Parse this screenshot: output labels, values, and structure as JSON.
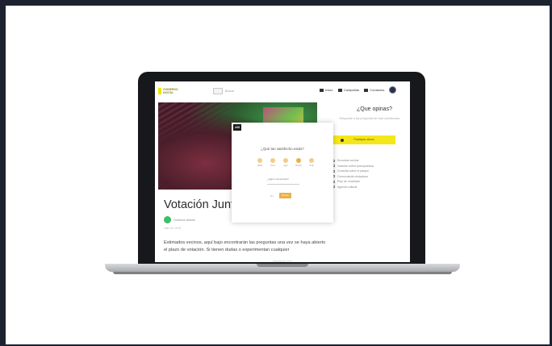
{
  "device": {
    "model_label": "MacBook Pro"
  },
  "site": {
    "logo_line1": "GOBIERNO",
    "logo_line2": "DIGITAL",
    "search_placeholder": "Buscar",
    "nav": [
      {
        "label": "Inicio",
        "icon": "home-icon"
      },
      {
        "label": "Campañas",
        "icon": "megaphone-icon"
      },
      {
        "label": "Contactos",
        "icon": "contacts-icon"
      }
    ]
  },
  "article": {
    "title": "Votación Junta",
    "author": "Gobierno Abierto",
    "meta": "Julio 20, 2019",
    "body": "Estimados vecinos, aquí bajo encontrarán las preguntas una vez se haya abierto el plazo de votación. Si tienen dudas o experimentan cualquier"
  },
  "sidebar": {
    "title": "¿Que opinas?",
    "description": "Responde a las preguntas de esta cuestionario",
    "button_label": "Participar ahora",
    "items": [
      "Encuesta vecinal",
      "Votación sobre presupuestos",
      "Consulta sobre el parque",
      "Convocatoria ciudadana",
      "Plan de movilidad",
      "Agenda cultural"
    ]
  },
  "modal": {
    "badge": "ASI",
    "question": "¿Qué tan satisfecho estás?",
    "options": [
      {
        "label": "Nada"
      },
      {
        "label": "Poco"
      },
      {
        "label": "Algo"
      },
      {
        "label": "Mucho",
        "selected": true
      },
      {
        "label": "Total"
      }
    ],
    "field_label": "¿Algún comentario?",
    "cancel_label": "No",
    "submit_label": "Enviar"
  },
  "colors": {
    "accent_yellow": "#f5e61b",
    "rating_gold": "#eab048",
    "author_green": "#3bbf6a"
  }
}
